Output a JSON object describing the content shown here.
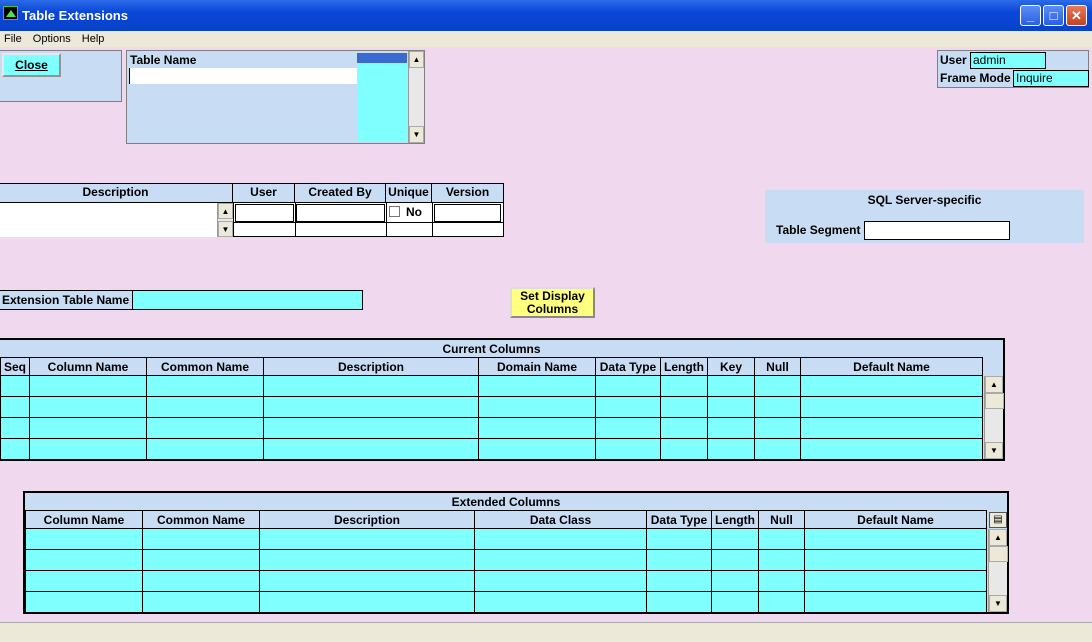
{
  "window": {
    "title": "Table Extensions"
  },
  "menu": [
    "File",
    "Options",
    "Help"
  ],
  "close_button": "Close",
  "table_name": {
    "label": "Table Name",
    "value": ""
  },
  "user": {
    "label": "User",
    "value": "admin"
  },
  "frame_mode": {
    "label": "Frame Mode",
    "value": "Inquire"
  },
  "info": {
    "headers": [
      "Description",
      "User",
      "Created By",
      "Unique",
      "Version"
    ],
    "unique_value": "No"
  },
  "sql": {
    "title": "SQL Server-specific",
    "segment_label": "Table Segment",
    "segment_value": ""
  },
  "extension_table": {
    "label": "Extension Table Name",
    "value": ""
  },
  "set_display_button": "Set Display Columns",
  "current_columns": {
    "title": "Current Columns",
    "headers": [
      "Seq",
      "Column Name",
      "Common Name",
      "Description",
      "Domain Name",
      "Data Type",
      "Length",
      "Key",
      "Null",
      "Default Name"
    ],
    "row_count": 4
  },
  "extended_columns": {
    "title": "Extended Columns",
    "headers": [
      "Column Name",
      "Common Name",
      "Description",
      "Data Class",
      "Data Type",
      "Length",
      "Null",
      "Default Name"
    ],
    "row_count": 4
  },
  "colors": {
    "background": "#f0d8ee",
    "panel": "#c8dcf4",
    "cell": "#80ffff",
    "title_bar": "#0a46d8",
    "button_yellow": "#ffff80"
  }
}
